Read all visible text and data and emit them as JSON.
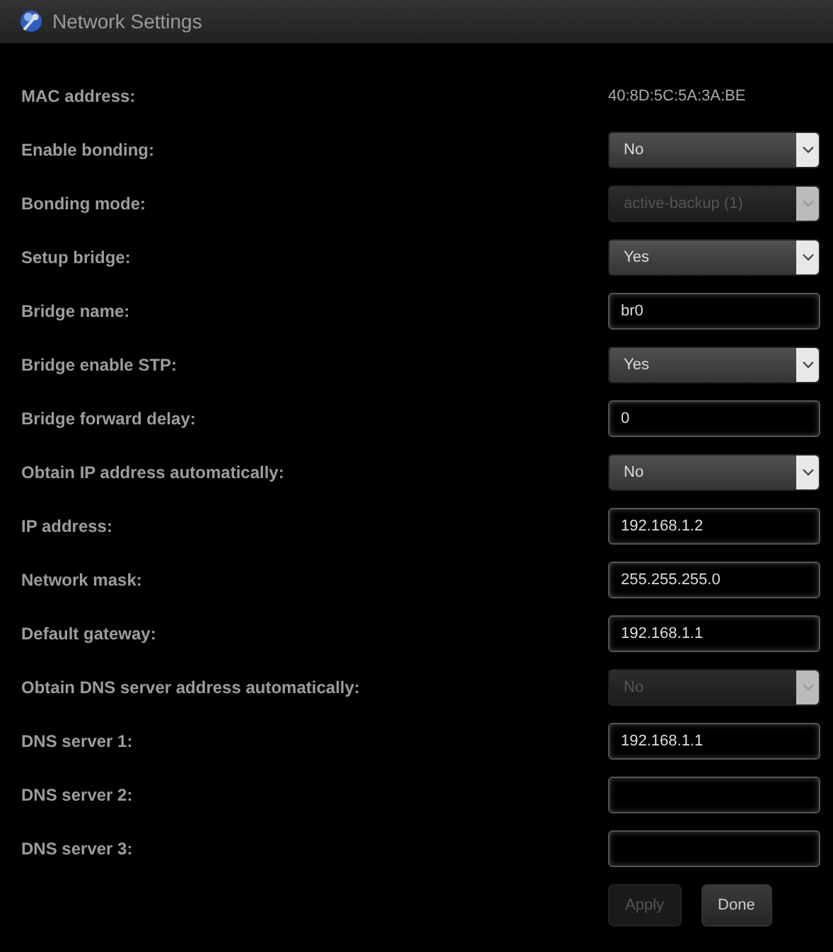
{
  "window": {
    "title": "Network Settings"
  },
  "fields": [
    {
      "label": "MAC address:",
      "kind": "text",
      "value": "40:8D:5C:5A:3A:BE"
    },
    {
      "label": "Enable bonding:",
      "kind": "select",
      "value": "No",
      "disabled": false
    },
    {
      "label": "Bonding mode:",
      "kind": "select",
      "value": "active-backup (1)",
      "disabled": true
    },
    {
      "label": "Setup bridge:",
      "kind": "select",
      "value": "Yes",
      "disabled": false
    },
    {
      "label": "Bridge name:",
      "kind": "input",
      "value": "br0"
    },
    {
      "label": "Bridge enable STP:",
      "kind": "select",
      "value": "Yes",
      "disabled": false
    },
    {
      "label": "Bridge forward delay:",
      "kind": "input",
      "value": "0"
    },
    {
      "label": "Obtain IP address automatically:",
      "kind": "select",
      "value": "No",
      "disabled": false
    },
    {
      "label": "IP address:",
      "kind": "input",
      "value": "192.168.1.2"
    },
    {
      "label": "Network mask:",
      "kind": "input",
      "value": "255.255.255.0"
    },
    {
      "label": "Default gateway:",
      "kind": "input",
      "value": "192.168.1.1"
    },
    {
      "label": "Obtain DNS server address automatically:",
      "kind": "select",
      "value": "No",
      "disabled": true
    },
    {
      "label": "DNS server 1:",
      "kind": "input",
      "value": "192.168.1.1"
    },
    {
      "label": "DNS server 2:",
      "kind": "input"
    },
    {
      "label": "DNS server 3:",
      "kind": "input"
    }
  ],
  "buttons": [
    {
      "label": "Apply",
      "disabled": true
    },
    {
      "label": "Done",
      "disabled": false
    }
  ]
}
